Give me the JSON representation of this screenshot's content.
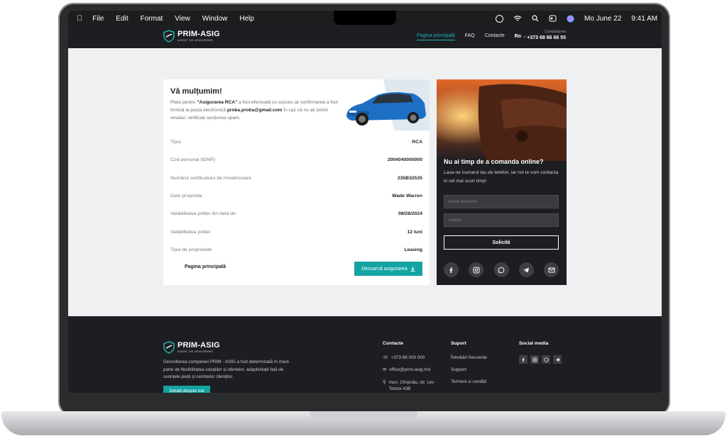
{
  "menubar": {
    "items": [
      "File",
      "Edit",
      "Format",
      "View",
      "Window",
      "Help"
    ],
    "date": "Mo June 22",
    "time": "9:41 AM"
  },
  "header": {
    "logo_name": "PRIM-ASIG",
    "logo_sub": "AGENT DE ASIGURARE",
    "nav": [
      "Pagina principală",
      "FAQ",
      "Contacte",
      "Ro"
    ],
    "contact_label": "Contactați-ne",
    "phone": "+373 68 66 66 55"
  },
  "card": {
    "title": "Vă mulțumim!",
    "text_1": "Plata pentru ",
    "text_bold_1": "\"Asigurarea RCA\"",
    "text_2": " a fost efectuată cu succes iar confirmarea a fost trimisă la poșta electronică ",
    "text_bold_2": "proba.proba@gmail.com",
    "text_3": " În caz că nu ați primit emailul, verificați secțiunea spam.",
    "rows": [
      {
        "label": "Tipul",
        "value": "RCA"
      },
      {
        "label": "Cod personal (IDNP)",
        "value": "2004040000000"
      },
      {
        "label": "Numărul certificatului de înmatriculare",
        "value": "235B32535"
      },
      {
        "label": "Date proprietar",
        "value": "Wade Warren"
      },
      {
        "label": "Valabilitatea poliței din data de:",
        "value": "08/28/2024"
      },
      {
        "label": "Valabilitatea poliței",
        "value": "12 luni"
      },
      {
        "label": "Tipul de proprietate",
        "value": "Leasing"
      }
    ],
    "home_link": "Pagina principală",
    "download_btn": "Descarcă asigurarea"
  },
  "panel": {
    "title": "Nu ai timp de a comanda online?",
    "text": "Lasa-ne numarul tau de telefon, iar noi te vom contacta in cel mai scurt timp!",
    "name_placeholder": "Nume prenume",
    "phone_placeholder": "Telefon",
    "submit": "Solicită"
  },
  "footer": {
    "logo_name": "PRIM-ASIG",
    "logo_sub": "AGENT DE ASIGURARE",
    "description": "Dezvoltarea companiei PRIM - ASIG a fost determinată în mare parte de flexibilitatea soluțiilor și ofertelor, adaptivitații față de cerințele pieții și cerințelor clienților.",
    "about_btn": "Detalii despre noi",
    "contacts_title": "Contacte",
    "contacts": [
      "+373 68 000 000",
      "office@prim-asig.md",
      "mun. Chișinău, str. Lev Tolstoi 43B"
    ],
    "support_title": "Suport",
    "support": [
      "Întrebări frecvente",
      "Support",
      "Termeni si condiții"
    ],
    "social_title": "Social media"
  },
  "colors": {
    "accent": "#14a3a3",
    "dark": "#1d1e22"
  }
}
